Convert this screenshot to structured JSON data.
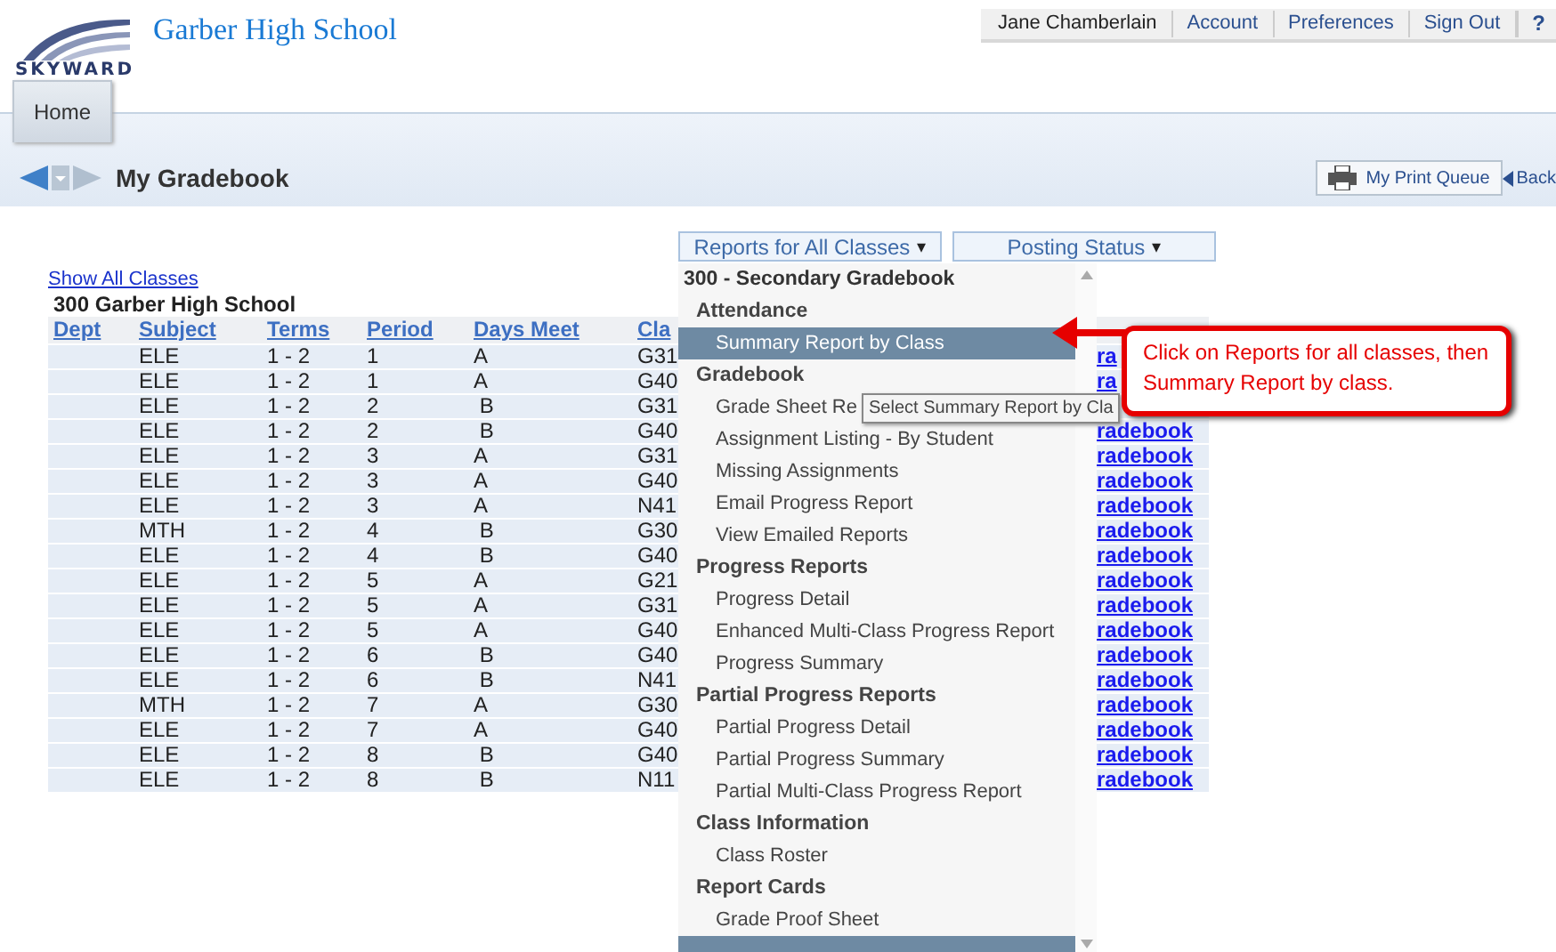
{
  "header": {
    "logo_text": "SKYWARD",
    "school_name": "Garber High School",
    "user_menu": [
      "Jane Chamberlain",
      "Account",
      "Preferences",
      "Sign Out",
      "?"
    ]
  },
  "tabs": [
    {
      "label": "Home",
      "selected": true
    }
  ],
  "page": {
    "title": "My Gradebook",
    "print_queue": "My Print Queue",
    "back": "Back"
  },
  "toolbar": {
    "buttons": [
      {
        "label": "Reports for All Classes",
        "caret": "▾"
      },
      {
        "label": "Posting Status",
        "caret": "▾"
      }
    ]
  },
  "show_all_link": "Show All Classes",
  "school_heading": "300 Garber High School",
  "table": {
    "columns": [
      "Dept",
      "Subject",
      "Terms",
      "Period",
      "Days Meet",
      "Cla"
    ],
    "rows": [
      {
        "subject": "ELE",
        "terms": "1 - 2",
        "period": "1",
        "days": "A",
        "class": "G31",
        "link": "ra"
      },
      {
        "subject": "ELE",
        "terms": "1 - 2",
        "period": "1",
        "days": "A",
        "class": "G40",
        "link": "ra"
      },
      {
        "subject": "ELE",
        "terms": "1 - 2",
        "period": "2",
        "days": " B",
        "class": "G31"
      },
      {
        "subject": "ELE",
        "terms": "1 - 2",
        "period": "2",
        "days": " B",
        "class": "G40",
        "link": "radebook"
      },
      {
        "subject": "ELE",
        "terms": "1 - 2",
        "period": "3",
        "days": "A",
        "class": "G31",
        "link": "radebook"
      },
      {
        "subject": "ELE",
        "terms": "1 - 2",
        "period": "3",
        "days": "A",
        "class": "G40",
        "link": "radebook"
      },
      {
        "subject": "ELE",
        "terms": "1 - 2",
        "period": "3",
        "days": "A",
        "class": "N41",
        "link": "radebook"
      },
      {
        "subject": "MTH",
        "terms": "1 - 2",
        "period": "4",
        "days": " B",
        "class": "G30",
        "link": "radebook"
      },
      {
        "subject": "ELE",
        "terms": "1 - 2",
        "period": "4",
        "days": " B",
        "class": "G40",
        "link": "radebook"
      },
      {
        "subject": "ELE",
        "terms": "1 - 2",
        "period": "5",
        "days": "A",
        "class": "G21",
        "link": "radebook"
      },
      {
        "subject": "ELE",
        "terms": "1 - 2",
        "period": "5",
        "days": "A",
        "class": "G31",
        "link": "radebook"
      },
      {
        "subject": "ELE",
        "terms": "1 - 2",
        "period": "5",
        "days": "A",
        "class": "G40",
        "link": "radebook"
      },
      {
        "subject": "ELE",
        "terms": "1 - 2",
        "period": "6",
        "days": " B",
        "class": "G40",
        "link": "radebook"
      },
      {
        "subject": "ELE",
        "terms": "1 - 2",
        "period": "6",
        "days": " B",
        "class": "N41",
        "link": "radebook"
      },
      {
        "subject": "MTH",
        "terms": "1 - 2",
        "period": "7",
        "days": "A",
        "class": "G30",
        "link": "radebook"
      },
      {
        "subject": "ELE",
        "terms": "1 - 2",
        "period": "7",
        "days": "A",
        "class": "G40",
        "link": "radebook"
      },
      {
        "subject": "ELE",
        "terms": "1 - 2",
        "period": "8",
        "days": " B",
        "class": "G40",
        "link": "radebook"
      },
      {
        "subject": "ELE",
        "terms": "1 - 2",
        "period": "8",
        "days": " B",
        "class": "N11",
        "link": "radebook"
      }
    ]
  },
  "dropdown": {
    "items": [
      {
        "kind": "title",
        "label": "300 - Secondary Gradebook",
        "selected": false
      },
      {
        "kind": "group",
        "label": "Attendance",
        "selected": false
      },
      {
        "kind": "item",
        "label": "Summary Report by Class",
        "selected": true
      },
      {
        "kind": "group",
        "label": "Gradebook",
        "selected": false
      },
      {
        "kind": "item",
        "label": "Grade Sheet Re",
        "selected": false
      },
      {
        "kind": "item",
        "label": "Assignment Listing - By Student",
        "selected": false
      },
      {
        "kind": "item",
        "label": "Missing Assignments",
        "selected": false
      },
      {
        "kind": "item",
        "label": "Email Progress Report",
        "selected": false
      },
      {
        "kind": "item",
        "label": "View Emailed Reports",
        "selected": false
      },
      {
        "kind": "group",
        "label": "Progress Reports",
        "selected": false
      },
      {
        "kind": "item",
        "label": "Progress Detail",
        "selected": false
      },
      {
        "kind": "item",
        "label": "Enhanced Multi-Class Progress Report",
        "selected": false
      },
      {
        "kind": "item",
        "label": "Progress Summary",
        "selected": false
      },
      {
        "kind": "group",
        "label": "Partial Progress Reports",
        "selected": false
      },
      {
        "kind": "item",
        "label": "Partial Progress Detail",
        "selected": false
      },
      {
        "kind": "item",
        "label": "Partial Progress Summary",
        "selected": false
      },
      {
        "kind": "item",
        "label": "Partial Multi-Class Progress Report",
        "selected": false
      },
      {
        "kind": "group",
        "label": "Class Information",
        "selected": false
      },
      {
        "kind": "item",
        "label": "Class Roster",
        "selected": false
      },
      {
        "kind": "group",
        "label": "Report Cards",
        "selected": false
      },
      {
        "kind": "item",
        "label": "Grade Proof Sheet",
        "selected": false
      }
    ]
  },
  "tooltip": "Select Summary Report by Cla",
  "callout": "Click on Reports for all classes, then Summary Report by class."
}
